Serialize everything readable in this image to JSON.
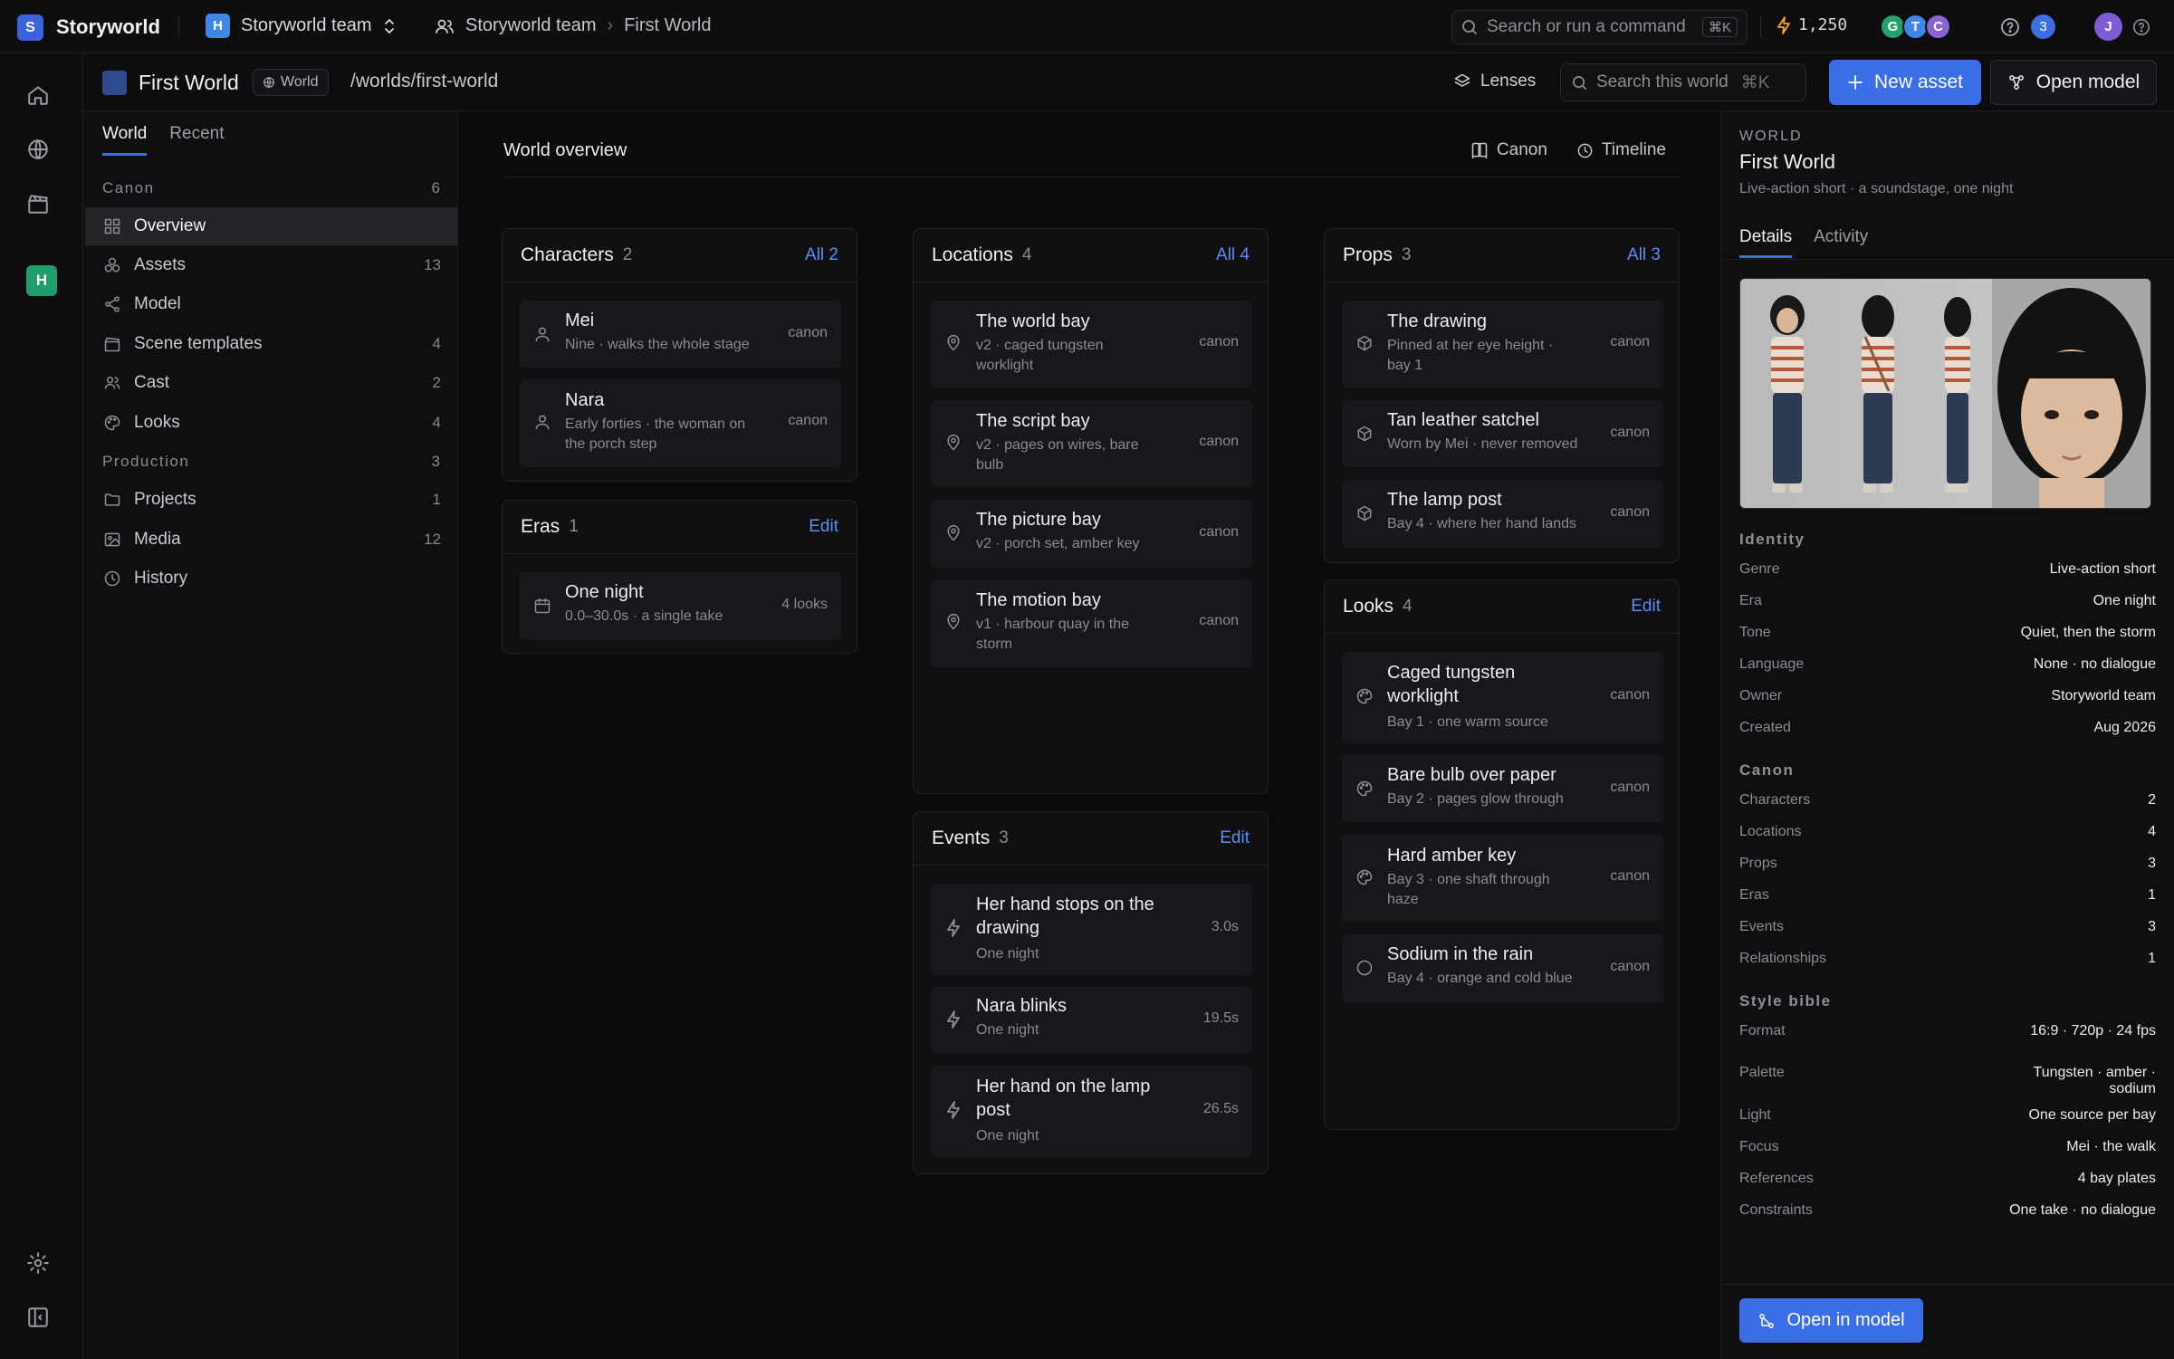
{
  "app": {
    "logo_letter": "S",
    "name": "Storyworld"
  },
  "team_switcher": {
    "badge": "H",
    "label": "Storyworld team"
  },
  "breadcrumb": [
    "Storyworld team",
    "First World"
  ],
  "command_search": {
    "placeholder": "Search or run a command",
    "shortcut": "⌘K"
  },
  "credits": "1,250",
  "collaborators": [
    {
      "initial": "G",
      "color": "#23a36b"
    },
    {
      "initial": "T",
      "color": "#3e86e8"
    },
    {
      "initial": "C",
      "color": "#8a63d2"
    }
  ],
  "notifications": "3",
  "user": {
    "initial": "J"
  },
  "world_header": {
    "title": "First World",
    "tag": "World",
    "path": "/worlds/first-world",
    "lenses": "Lenses",
    "search_placeholder": "Search this world",
    "search_shortcut": "⌘K",
    "new_asset": "New asset",
    "open_model": "Open model"
  },
  "sidebar": {
    "tabs": [
      "World",
      "Recent"
    ],
    "canon": {
      "label": "Canon",
      "count": "6"
    },
    "canon_items": [
      {
        "label": "Overview",
        "count": ""
      },
      {
        "label": "Assets",
        "count": "13"
      },
      {
        "label": "Model",
        "count": ""
      },
      {
        "label": "Scene templates",
        "count": "4"
      },
      {
        "label": "Cast",
        "count": "2"
      },
      {
        "label": "Looks",
        "count": "4"
      }
    ],
    "production": {
      "label": "Production",
      "count": "3"
    },
    "production_items": [
      {
        "label": "Projects",
        "count": "1"
      },
      {
        "label": "Media",
        "count": "12"
      },
      {
        "label": "History",
        "count": ""
      }
    ]
  },
  "main": {
    "title": "World overview",
    "links": [
      "Canon",
      "Timeline"
    ],
    "characters": {
      "title": "Characters",
      "count": "2",
      "link": "All 2",
      "items": [
        {
          "title": "Mei",
          "sub": "Nine · walks the whole stage",
          "tag": "canon"
        },
        {
          "title": "Nara",
          "sub": "Early forties · the woman on",
          "sub2": "the porch step",
          "tag": "canon"
        }
      ]
    },
    "eras": {
      "title": "Eras",
      "count": "1",
      "link": "Edit",
      "items": [
        {
          "title": "One night",
          "sub": "0.0–30.0s · a single take",
          "tag": "4 looks"
        }
      ]
    },
    "locations": {
      "title": "Locations",
      "count": "4",
      "link": "All 4",
      "items": [
        {
          "title": "The world bay",
          "sub": "v2 · caged tungsten",
          "sub2": "worklight",
          "tag": "canon"
        },
        {
          "title": "The script bay",
          "sub": "v2 · pages on wires, bare",
          "sub2": "bulb",
          "tag": "canon"
        },
        {
          "title": "The picture bay",
          "sub": "v2 · porch set, amber key",
          "tag": "canon"
        },
        {
          "title": "The motion bay",
          "sub": "v1 · harbour quay in the",
          "sub2": "storm",
          "tag": "canon"
        }
      ]
    },
    "events": {
      "title": "Events",
      "count": "3",
      "link": "Edit",
      "items": [
        {
          "title": "Her hand stops on the",
          "title2": "drawing",
          "sub": "One night",
          "tag": "3.0s"
        },
        {
          "title": "Nara blinks",
          "sub": "One night",
          "tag": "19.5s"
        },
        {
          "title": "Her hand on the lamp",
          "title2": "post",
          "sub": "One night",
          "tag": "26.5s"
        }
      ]
    },
    "props": {
      "title": "Props",
      "count": "3",
      "link": "All 3",
      "items": [
        {
          "title": "The drawing",
          "sub": "Pinned at her eye height ·",
          "sub2": "bay 1",
          "tag": "canon"
        },
        {
          "title": "Tan leather satchel",
          "sub": "Worn by Mei · never removed",
          "tag": "canon"
        },
        {
          "title": "The lamp post",
          "sub": "Bay 4 · where her hand lands",
          "tag": "canon"
        }
      ]
    },
    "looks": {
      "title": "Looks",
      "count": "4",
      "link": "Edit",
      "items": [
        {
          "title": "Caged tungsten",
          "title2": "worklight",
          "sub": "Bay 1 · one warm source",
          "tag": "canon"
        },
        {
          "title": "Bare bulb over paper",
          "sub": "Bay 2 · pages glow through",
          "tag": "canon"
        },
        {
          "title": "Hard amber key",
          "sub": "Bay 3 · one shaft through",
          "sub2": "haze",
          "tag": "canon"
        },
        {
          "title": "Sodium in the rain",
          "sub": "Bay 4 · orange and cold blue",
          "tag": "canon"
        }
      ]
    }
  },
  "details": {
    "kicker": "WORLD",
    "title": "First World",
    "subtitle": "Live-action short · a soundstage, one night",
    "tabs": [
      "Details",
      "Activity"
    ],
    "identity_label": "Identity",
    "identity": [
      {
        "k": "Genre",
        "v": "Live-action short"
      },
      {
        "k": "Era",
        "v": "One night"
      },
      {
        "k": "Tone",
        "v": "Quiet, then the storm"
      },
      {
        "k": "Language",
        "v": "None · no dialogue"
      },
      {
        "k": "Owner",
        "v": "Storyworld team"
      },
      {
        "k": "Created",
        "v": "Aug 2026"
      }
    ],
    "canon_label": "Canon",
    "canon": [
      {
        "k": "Characters",
        "v": "2"
      },
      {
        "k": "Locations",
        "v": "4"
      },
      {
        "k": "Props",
        "v": "3"
      },
      {
        "k": "Eras",
        "v": "1"
      },
      {
        "k": "Events",
        "v": "3"
      },
      {
        "k": "Relationships",
        "v": "1"
      }
    ],
    "style_label": "Style bible",
    "style": [
      {
        "k": "Format",
        "v": "16:9 · 720p · 24 fps"
      },
      {
        "k": "Palette",
        "v": "Tungsten · amber ·",
        "v2": "sodium"
      },
      {
        "k": "Light",
        "v": "One source per bay"
      },
      {
        "k": "Focus",
        "v": "Mei · the walk"
      },
      {
        "k": "References",
        "v": "4 bay plates"
      },
      {
        "k": "Constraints",
        "v": "One take · no dialogue"
      }
    ],
    "open_in_model": "Open in model"
  }
}
